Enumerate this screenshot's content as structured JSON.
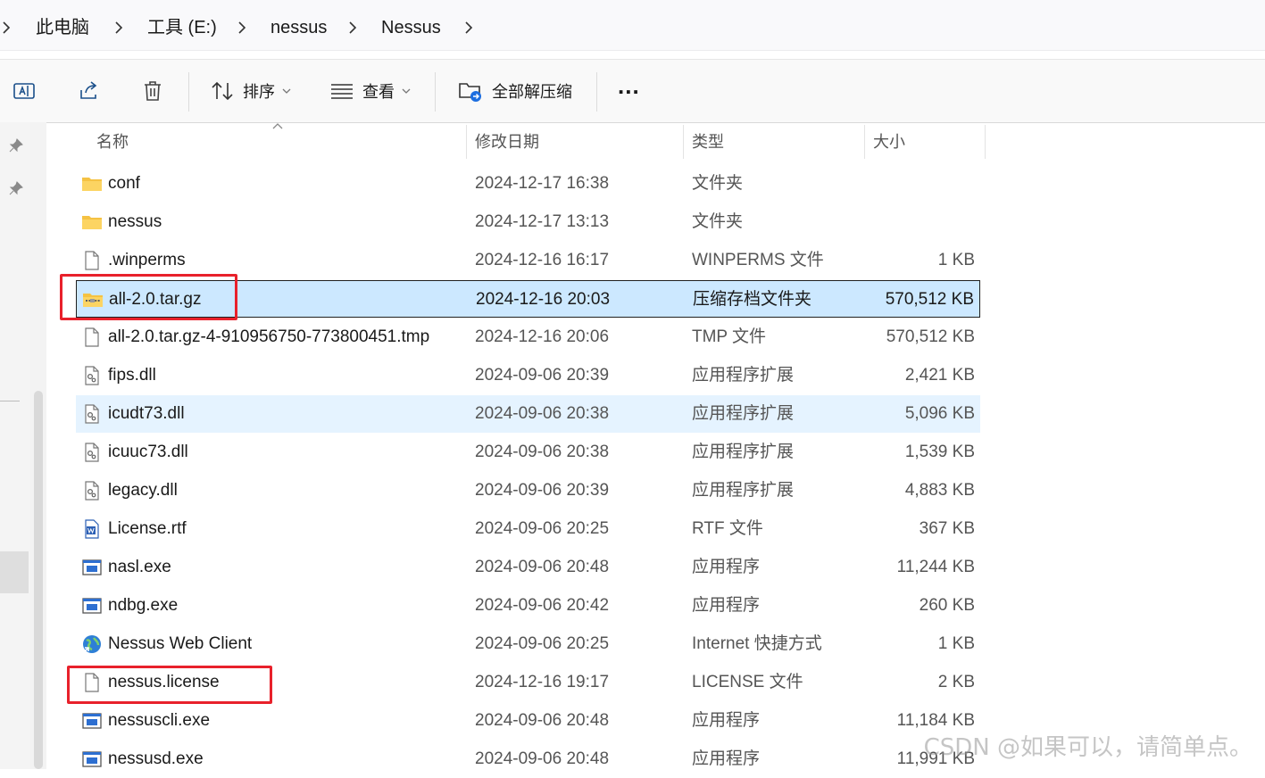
{
  "breadcrumb": {
    "items": [
      "此电脑",
      "工具 (E:)",
      "nessus",
      "Nessus"
    ]
  },
  "commands": {
    "sort_label": "排序",
    "view_label": "查看",
    "extract_label": "全部解压缩",
    "more_label": "..."
  },
  "columns": {
    "name": "名称",
    "date": "修改日期",
    "type": "类型",
    "size": "大小"
  },
  "files": [
    {
      "name": "conf",
      "date": "2024-12-17 16:38",
      "type": "文件夹",
      "size": "",
      "icon": "folder-icon"
    },
    {
      "name": "nessus",
      "date": "2024-12-17 13:13",
      "type": "文件夹",
      "size": "",
      "icon": "folder-icon"
    },
    {
      "name": ".winperms",
      "date": "2024-12-16 16:17",
      "type": "WINPERMS 文件",
      "size": "1 KB",
      "icon": "file-icon"
    },
    {
      "name": "all-2.0.tar.gz",
      "date": "2024-12-16 20:03",
      "type": "压缩存档文件夹",
      "size": "570,512 KB",
      "icon": "zip-folder-icon"
    },
    {
      "name": "all-2.0.tar.gz-4-910956750-773800451.tmp",
      "date": "2024-12-16 20:06",
      "type": "TMP 文件",
      "size": "570,512 KB",
      "icon": "file-icon"
    },
    {
      "name": "fips.dll",
      "date": "2024-09-06 20:39",
      "type": "应用程序扩展",
      "size": "2,421 KB",
      "icon": "dll-icon"
    },
    {
      "name": "icudt73.dll",
      "date": "2024-09-06 20:38",
      "type": "应用程序扩展",
      "size": "5,096 KB",
      "icon": "dll-icon"
    },
    {
      "name": "icuuc73.dll",
      "date": "2024-09-06 20:38",
      "type": "应用程序扩展",
      "size": "1,539 KB",
      "icon": "dll-icon"
    },
    {
      "name": "legacy.dll",
      "date": "2024-09-06 20:39",
      "type": "应用程序扩展",
      "size": "4,883 KB",
      "icon": "dll-icon"
    },
    {
      "name": "License.rtf",
      "date": "2024-09-06 20:25",
      "type": "RTF 文件",
      "size": "367 KB",
      "icon": "word-doc-icon"
    },
    {
      "name": "nasl.exe",
      "date": "2024-09-06 20:48",
      "type": "应用程序",
      "size": "11,244 KB",
      "icon": "exe-icon"
    },
    {
      "name": "ndbg.exe",
      "date": "2024-09-06 20:42",
      "type": "应用程序",
      "size": "260 KB",
      "icon": "exe-icon"
    },
    {
      "name": "Nessus Web Client",
      "date": "2024-09-06 20:25",
      "type": "Internet 快捷方式",
      "size": "1 KB",
      "icon": "internet-shortcut-icon"
    },
    {
      "name": "nessus.license",
      "date": "2024-12-16 19:17",
      "type": "LICENSE 文件",
      "size": "2 KB",
      "icon": "file-icon"
    },
    {
      "name": "nessuscli.exe",
      "date": "2024-09-06 20:48",
      "type": "应用程序",
      "size": "11,184 KB",
      "icon": "exe-icon"
    },
    {
      "name": "nessusd.exe",
      "date": "2024-09-06 20:48",
      "type": "应用程序",
      "size": "11,991 KB",
      "icon": "exe-icon"
    }
  ],
  "watermark": "CSDN @如果可以，请简单点。",
  "colors": {
    "selected_bg": "#cce8ff",
    "hover_bg": "#e5f3ff",
    "annotation": "#e8212b",
    "folder": "#f5c243"
  }
}
